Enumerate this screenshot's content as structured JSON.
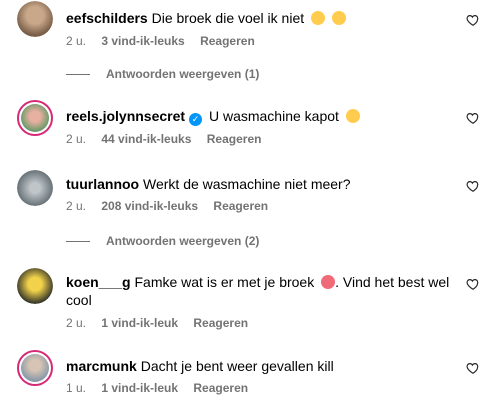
{
  "comments": [
    {
      "username": "eefschilders",
      "text": "Die broek die voel ik niet",
      "emojis": [
        "sweat-face-emoji",
        "blush-face-emoji"
      ],
      "time": "2 u.",
      "likes": "3 vind-ik-leuks",
      "reply_label": "Reageren",
      "view_replies": "Antwoorden weergeven (1)"
    },
    {
      "username": "reels.jolynnsecret",
      "verified": true,
      "text": "U wasmachine kapot",
      "emojis": [
        "laughing-face-emoji"
      ],
      "time": "2 u.",
      "likes": "44 vind-ik-leuks",
      "reply_label": "Reageren"
    },
    {
      "username": "tuurlannoo",
      "text": "Werkt de wasmachine niet meer?",
      "time": "2 u.",
      "likes": "208 vind-ik-leuks",
      "reply_label": "Reageren",
      "view_replies": "Antwoorden weergeven (2)"
    },
    {
      "username": "koen___g",
      "text_before": "Famke wat is er met je broek",
      "emojis": [
        "shocked-face-emoji"
      ],
      "text_after": ". Vind het best wel cool",
      "time": "2 u.",
      "likes": "1 vind-ik-leuk",
      "reply_label": "Reageren"
    },
    {
      "username": "marcmunk",
      "text": "Dacht je bent weer gevallen kill",
      "time": "1 u.",
      "likes": "1 vind-ik-leuk",
      "reply_label": "Reageren"
    }
  ],
  "colors": {
    "meta_text": "#737373",
    "story_ring": "#d62976",
    "verified_badge": "#0095f6"
  }
}
